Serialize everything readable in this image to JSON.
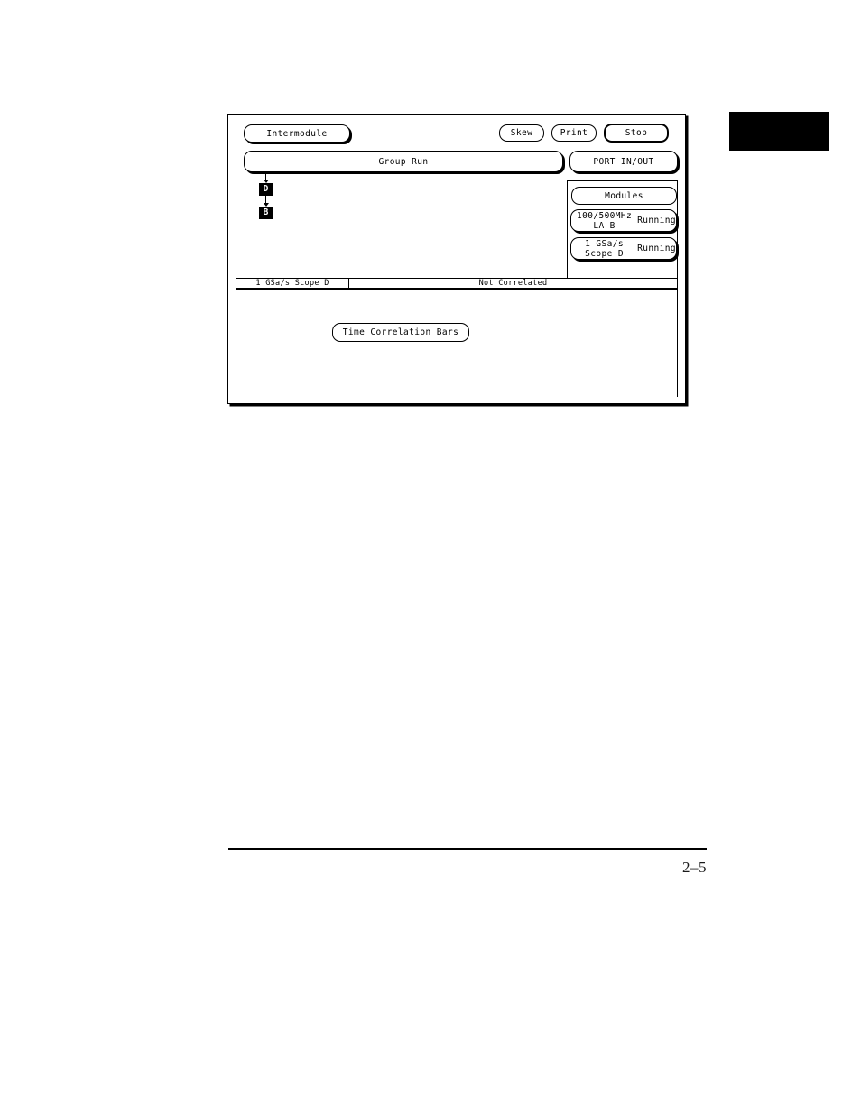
{
  "page": {
    "number": "2–5",
    "tab_marker": "black-tab"
  },
  "callout": {
    "present": true
  },
  "screen": {
    "toolbar": {
      "intermodule_label": "Intermodule",
      "skew_label": "Skew",
      "print_label": "Print",
      "stop_label": "Stop"
    },
    "arm_row": {
      "group_run_label": "Group Run",
      "port_in_out_label": "PORT IN/OUT"
    },
    "flow": {
      "nodes": [
        {
          "label": "D"
        },
        {
          "label": "B"
        }
      ]
    },
    "modules_panel": {
      "header_label": "Modules",
      "items": [
        {
          "name": "100/500MHz LA B",
          "state": "Running"
        },
        {
          "name": "1 GSa/s Scope D",
          "state": "Running"
        }
      ]
    },
    "time_correlation_bars_label": "Time Correlation Bars",
    "status_bar": {
      "module": "1 GSa/s Scope D",
      "state": "Not Correlated"
    }
  }
}
